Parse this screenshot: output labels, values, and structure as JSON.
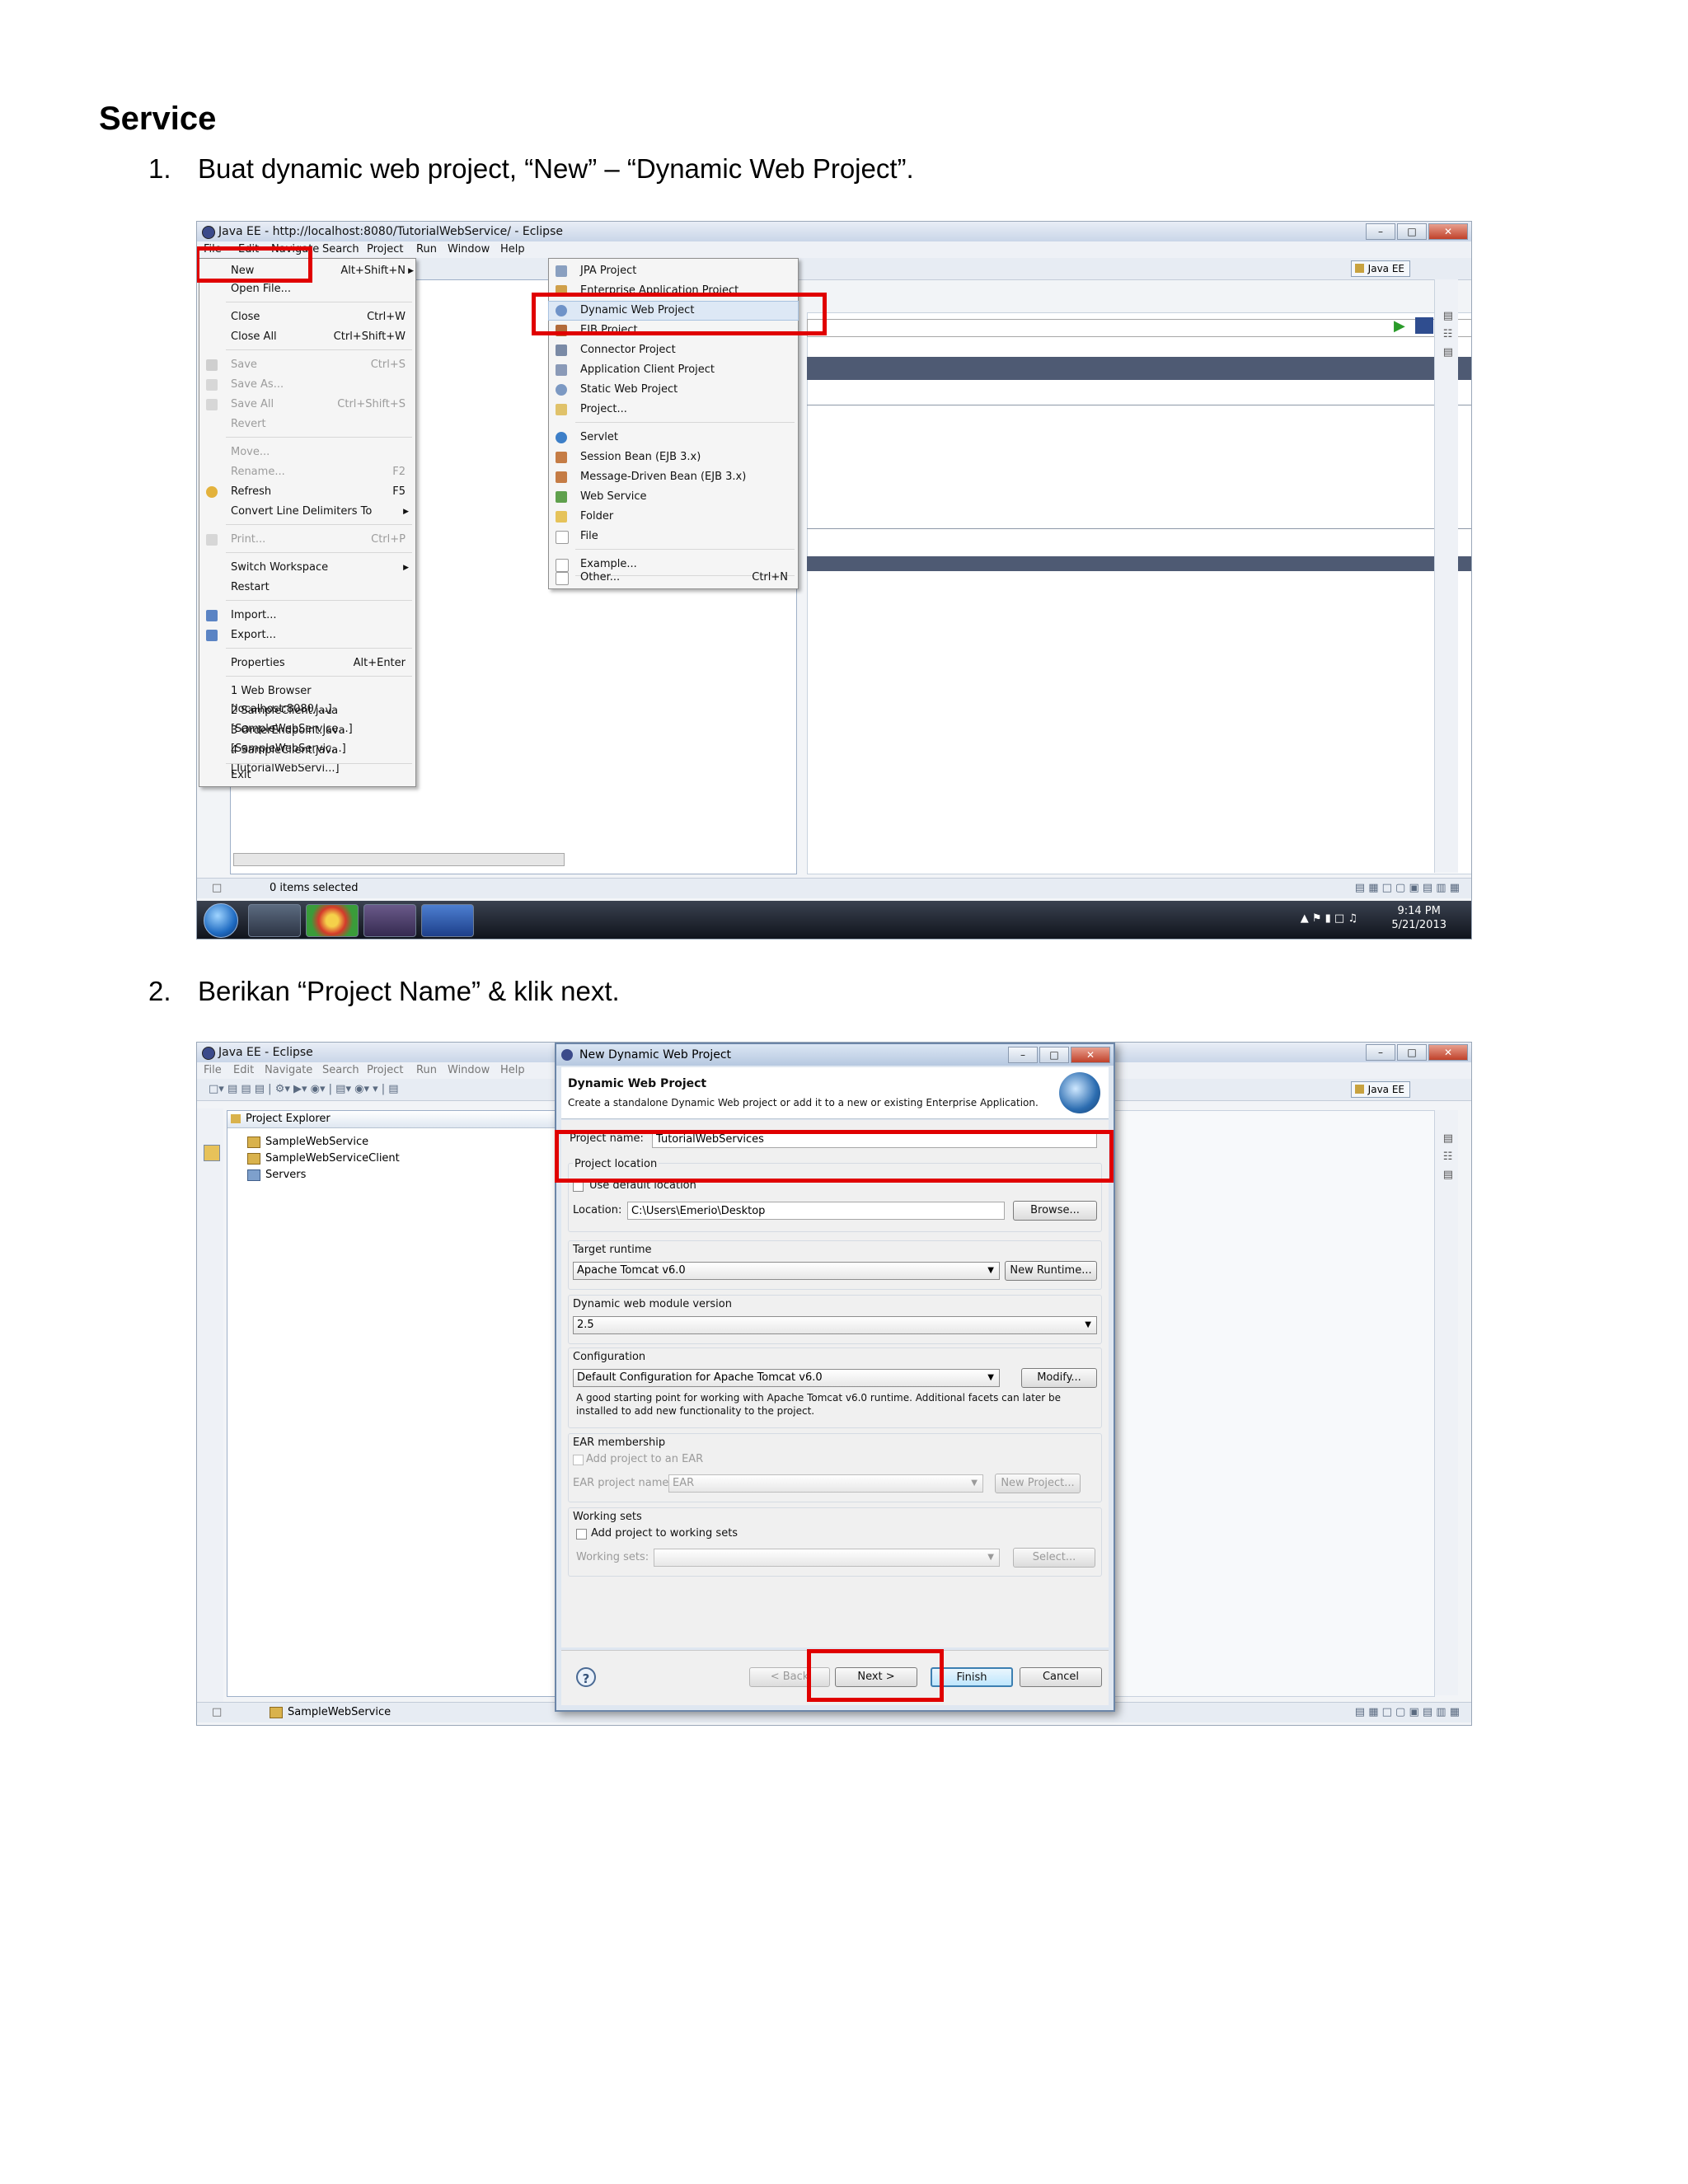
{
  "heading": "Service",
  "steps": [
    {
      "number": "1.",
      "text": "Buat dynamic web project, “New” – “Dynamic Web Project”."
    },
    {
      "number": "2.",
      "text": "Berikan “Project Name” & klik next."
    }
  ],
  "screenshot1": {
    "window_title": "Java EE - http://localhost:8080/TutorialWebService/ - Eclipse",
    "menubar": [
      "File",
      "Edit",
      "Navigate",
      "Search",
      "Project",
      "Run",
      "Window",
      "Help"
    ],
    "perspective": "Java EE",
    "file_menu": [
      {
        "label": "New",
        "accel": "Alt+Shift+N",
        "submenu": true
      },
      {
        "label": "Open File...",
        "accel": ""
      },
      {
        "label": "Close",
        "accel": "Ctrl+W"
      },
      {
        "label": "Close All",
        "accel": "Ctrl+Shift+W"
      },
      {
        "label": "Save",
        "accel": "Ctrl+S",
        "disabled": true
      },
      {
        "label": "Save As...",
        "accel": "",
        "disabled": true
      },
      {
        "label": "Save All",
        "accel": "Ctrl+Shift+S",
        "disabled": true
      },
      {
        "label": "Revert",
        "accel": "",
        "disabled": true
      },
      {
        "label": "Move...",
        "accel": "",
        "disabled": true
      },
      {
        "label": "Rename...",
        "accel": "F2",
        "disabled": true
      },
      {
        "label": "Refresh",
        "accel": "F5"
      },
      {
        "label": "Convert Line Delimiters To",
        "accel": "",
        "submenu": true
      },
      {
        "label": "Print...",
        "accel": "Ctrl+P",
        "disabled": true
      },
      {
        "label": "Switch Workspace",
        "accel": "",
        "submenu": true
      },
      {
        "label": "Restart",
        "accel": ""
      },
      {
        "label": "Import...",
        "accel": ""
      },
      {
        "label": "Export...",
        "accel": ""
      },
      {
        "label": "Properties",
        "accel": "Alt+Enter"
      },
      {
        "label": "1 Web Browser  [localhost:8080/...]",
        "accel": ""
      },
      {
        "label": "2 SampleClient.java  [SampleWebService...]",
        "accel": ""
      },
      {
        "label": "3 OrderEndpoint.java  [SampleWebServic...]",
        "accel": ""
      },
      {
        "label": "4 SampleClient.java  [TutorialWebServi...]",
        "accel": ""
      },
      {
        "label": "Exit",
        "accel": ""
      }
    ],
    "new_submenu": [
      {
        "label": "JPA Project",
        "accel": ""
      },
      {
        "label": "Enterprise Application Project",
        "accel": ""
      },
      {
        "label": "Dynamic Web Project",
        "accel": ""
      },
      {
        "label": "EJB Project",
        "accel": ""
      },
      {
        "label": "Connector Project",
        "accel": ""
      },
      {
        "label": "Application Client Project",
        "accel": ""
      },
      {
        "label": "Static Web Project",
        "accel": ""
      },
      {
        "label": "Project...",
        "accel": ""
      },
      {
        "label": "Servlet",
        "accel": ""
      },
      {
        "label": "Session Bean (EJB 3.x)",
        "accel": ""
      },
      {
        "label": "Message-Driven Bean (EJB 3.x)",
        "accel": ""
      },
      {
        "label": "Web Service",
        "accel": ""
      },
      {
        "label": "Folder",
        "accel": ""
      },
      {
        "label": "File",
        "accel": ""
      },
      {
        "label": "Example...",
        "accel": ""
      },
      {
        "label": "Other...",
        "accel": "Ctrl+N"
      }
    ],
    "status": "0 items selected",
    "clock_time": "9:14 PM",
    "clock_date": "5/21/2013"
  },
  "screenshot2": {
    "window_title": "Java EE - Eclipse",
    "menubar": [
      "File",
      "Edit",
      "Navigate",
      "Search",
      "Project",
      "Run",
      "Window",
      "Help"
    ],
    "perspective": "Java EE",
    "explorer_title": "Project Explorer",
    "explorer_items": [
      "SampleWebService",
      "SampleWebServiceClient",
      "Servers"
    ],
    "status_item": "SampleWebService",
    "dialog": {
      "title": "New Dynamic Web Project",
      "header_title": "Dynamic Web Project",
      "header_desc": "Create a standalone Dynamic Web project or add it to a new or existing Enterprise Application.",
      "project_name_label": "Project name:",
      "project_name_value": "TutorialWebServices",
      "project_location_label": "Project location",
      "use_default_location": "Use default location",
      "location_label": "Location:",
      "location_value": "C:\\Users\\Emerio\\Desktop",
      "browse_button": "Browse...",
      "target_runtime_label": "Target runtime",
      "target_runtime_value": "Apache Tomcat v6.0",
      "new_runtime_button": "New Runtime...",
      "module_version_label": "Dynamic web module version",
      "module_version_value": "2.5",
      "configuration_label": "Configuration",
      "configuration_value": "Default Configuration for Apache Tomcat v6.0",
      "modify_button": "Modify...",
      "configuration_desc_1": "A good starting point for working with Apache Tomcat v6.0 runtime. Additional facets can later be",
      "configuration_desc_2": "installed to add new functionality to the project.",
      "ear_label": "EAR membership",
      "ear_checkbox": "Add project to an EAR",
      "ear_name_label": "EAR project name:",
      "ear_name_value": "EAR",
      "new_project_button": "New Project...",
      "working_sets_label": "Working sets",
      "working_sets_checkbox": "Add project to working sets",
      "working_sets_field_label": "Working sets:",
      "select_button": "Select...",
      "help_icon": "?",
      "back_button": "< Back",
      "next_button": "Next >",
      "finish_button": "Finish",
      "cancel_button": "Cancel"
    }
  }
}
